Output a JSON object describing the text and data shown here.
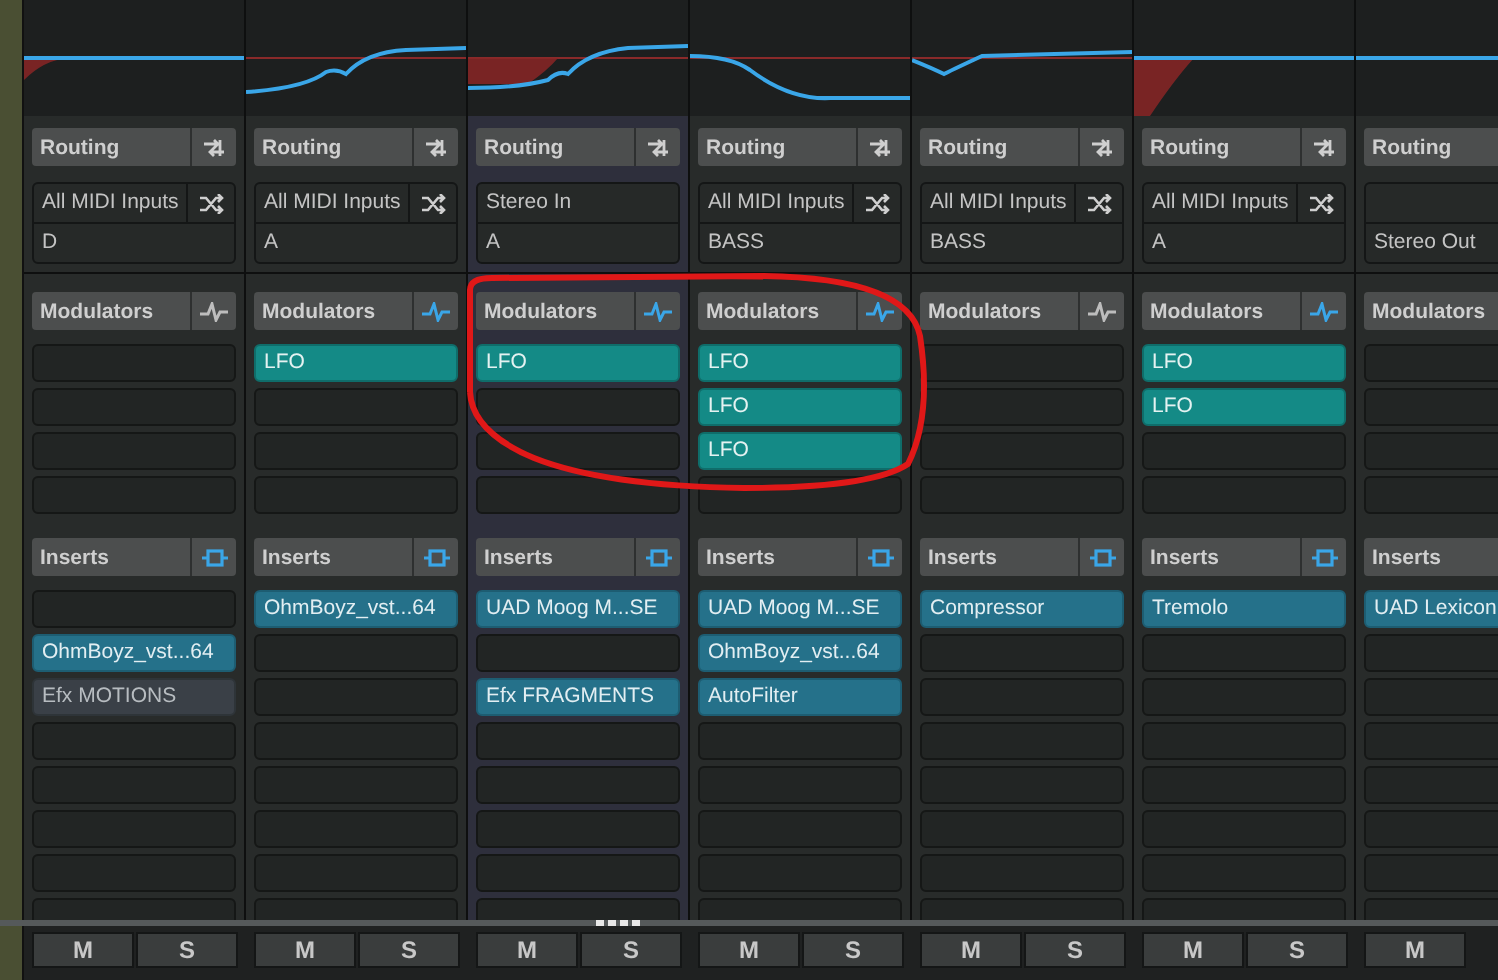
{
  "channels": [
    {
      "selected": false,
      "routing": {
        "title": "Routing",
        "kind": "midi",
        "input": "All MIDI Inputs",
        "output": "D"
      },
      "modulators": {
        "title": "Modulators",
        "active": false
      },
      "inserts": {
        "title": "Inserts",
        "slots": [
          {
            "kind": "empty"
          },
          {
            "kind": "plugin",
            "name": "OhmBoyz_vst...64",
            "active": true
          },
          {
            "kind": "plugin",
            "name": "Efx MOTIONS",
            "active": false
          },
          {
            "kind": "empty"
          },
          {
            "kind": "empty"
          },
          {
            "kind": "empty"
          },
          {
            "kind": "empty"
          },
          {
            "kind": "empty"
          }
        ]
      },
      "buttons": [
        "M",
        "S"
      ]
    },
    {
      "selected": false,
      "routing": {
        "title": "Routing",
        "kind": "midi",
        "input": "All MIDI Inputs",
        "output": "A"
      },
      "modulators": {
        "title": "Modulators",
        "active": true,
        "items": [
          "LFO"
        ]
      },
      "inserts": {
        "title": "Inserts",
        "slots": [
          {
            "kind": "plugin",
            "name": "OhmBoyz_vst...64",
            "active": true
          },
          {
            "kind": "empty"
          },
          {
            "kind": "empty"
          },
          {
            "kind": "empty"
          },
          {
            "kind": "empty"
          },
          {
            "kind": "empty"
          },
          {
            "kind": "empty"
          },
          {
            "kind": "empty"
          }
        ]
      },
      "buttons": [
        "M",
        "S"
      ]
    },
    {
      "selected": true,
      "routing": {
        "title": "Routing",
        "kind": "audio",
        "input": "Stereo In",
        "output": "A"
      },
      "modulators": {
        "title": "Modulators",
        "active": true,
        "items": [
          "LFO"
        ]
      },
      "inserts": {
        "title": "Inserts",
        "slots": [
          {
            "kind": "plugin",
            "name": "UAD Moog M...SE",
            "active": true
          },
          {
            "kind": "empty"
          },
          {
            "kind": "plugin",
            "name": "Efx FRAGMENTS",
            "active": true
          },
          {
            "kind": "empty"
          },
          {
            "kind": "empty"
          },
          {
            "kind": "empty"
          },
          {
            "kind": "empty"
          },
          {
            "kind": "empty"
          }
        ]
      },
      "buttons": [
        "M",
        "S"
      ]
    },
    {
      "selected": false,
      "routing": {
        "title": "Routing",
        "kind": "midi",
        "input": "All MIDI Inputs",
        "output": "BASS"
      },
      "modulators": {
        "title": "Modulators",
        "active": true,
        "items": [
          "LFO",
          "LFO",
          "LFO"
        ]
      },
      "inserts": {
        "title": "Inserts",
        "slots": [
          {
            "kind": "plugin",
            "name": "UAD Moog M...SE",
            "active": true
          },
          {
            "kind": "plugin",
            "name": "OhmBoyz_vst...64",
            "active": true
          },
          {
            "kind": "plugin",
            "name": "AutoFilter",
            "active": true
          },
          {
            "kind": "empty"
          },
          {
            "kind": "empty"
          },
          {
            "kind": "empty"
          },
          {
            "kind": "empty"
          },
          {
            "kind": "empty"
          }
        ]
      },
      "buttons": [
        "M",
        "S"
      ]
    },
    {
      "selected": false,
      "routing": {
        "title": "Routing",
        "kind": "midi",
        "input": "All MIDI Inputs",
        "output": "BASS"
      },
      "modulators": {
        "title": "Modulators",
        "active": false
      },
      "inserts": {
        "title": "Inserts",
        "slots": [
          {
            "kind": "plugin",
            "name": "Compressor",
            "active": true
          },
          {
            "kind": "empty"
          },
          {
            "kind": "empty"
          },
          {
            "kind": "empty"
          },
          {
            "kind": "empty"
          },
          {
            "kind": "empty"
          },
          {
            "kind": "empty"
          },
          {
            "kind": "empty"
          }
        ]
      },
      "buttons": [
        "M",
        "S"
      ]
    },
    {
      "selected": false,
      "routing": {
        "title": "Routing",
        "kind": "midi",
        "input": "All MIDI Inputs",
        "output": "A"
      },
      "modulators": {
        "title": "Modulators",
        "active": true,
        "items": [
          "LFO",
          "LFO"
        ]
      },
      "inserts": {
        "title": "Inserts",
        "slots": [
          {
            "kind": "plugin",
            "name": "Tremolo",
            "active": true
          },
          {
            "kind": "empty"
          },
          {
            "kind": "empty"
          },
          {
            "kind": "empty"
          },
          {
            "kind": "empty"
          },
          {
            "kind": "empty"
          },
          {
            "kind": "empty"
          },
          {
            "kind": "empty"
          }
        ]
      },
      "buttons": [
        "M",
        "S"
      ]
    },
    {
      "selected": false,
      "routing": {
        "title": "Routing",
        "kind": "none",
        "output": "Stereo Out"
      },
      "modulators": {
        "title": "Modulators"
      },
      "inserts": {
        "title": "Inserts",
        "slots": [
          {
            "kind": "plugin",
            "name": "UAD Lexicon",
            "active": true
          },
          {
            "kind": "empty"
          },
          {
            "kind": "empty"
          },
          {
            "kind": "empty"
          },
          {
            "kind": "empty"
          },
          {
            "kind": "empty"
          },
          {
            "kind": "empty"
          },
          {
            "kind": "empty"
          }
        ]
      },
      "buttons": [
        "M"
      ]
    }
  ]
}
